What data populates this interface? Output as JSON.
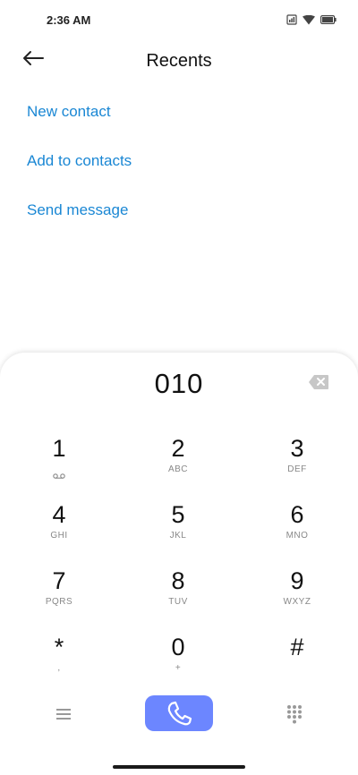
{
  "status": {
    "time": "2:36 AM"
  },
  "header": {
    "title": "Recents"
  },
  "actions": {
    "new_contact": "New contact",
    "add_to_contacts": "Add to contacts",
    "send_message": "Send message"
  },
  "dialer": {
    "number": "010",
    "keys": [
      {
        "digit": "1",
        "letters": ""
      },
      {
        "digit": "2",
        "letters": "ABC"
      },
      {
        "digit": "3",
        "letters": "DEF"
      },
      {
        "digit": "4",
        "letters": "GHI"
      },
      {
        "digit": "5",
        "letters": "JKL"
      },
      {
        "digit": "6",
        "letters": "MNO"
      },
      {
        "digit": "7",
        "letters": "PQRS"
      },
      {
        "digit": "8",
        "letters": "TUV"
      },
      {
        "digit": "9",
        "letters": "WXYZ"
      },
      {
        "digit": "*",
        "letters": ","
      },
      {
        "digit": "0",
        "letters": "+"
      },
      {
        "digit": "#",
        "letters": ""
      }
    ]
  },
  "colors": {
    "accent": "#1a87d4",
    "call_button": "#6c86ff"
  },
  "icons": {
    "status": [
      "sim-icon",
      "wifi-icon",
      "battery-icon"
    ],
    "header": "back-arrow-icon",
    "backspace": "backspace-icon",
    "voicemail": "voicemail-icon",
    "menu": "menu-icon",
    "call": "phone-icon",
    "keypad": "keypad-grid-icon"
  }
}
